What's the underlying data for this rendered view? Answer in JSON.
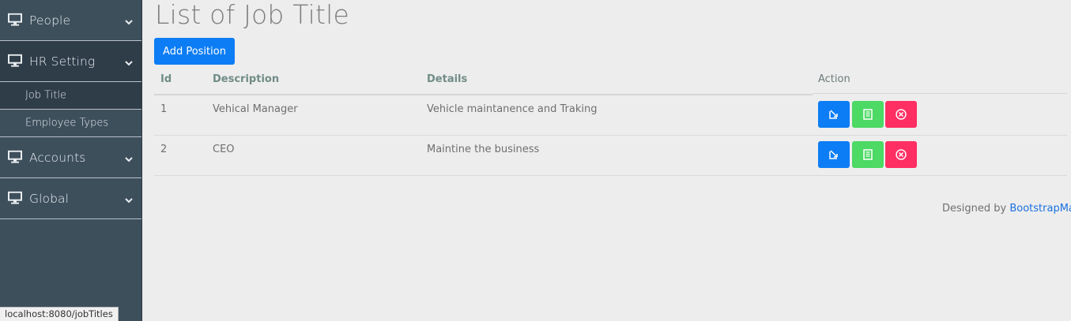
{
  "sidebar": {
    "items": [
      {
        "label": "People",
        "icon": "monitor-icon"
      },
      {
        "label": "HR Setting",
        "icon": "monitor-icon"
      },
      {
        "label": "Accounts",
        "icon": "monitor-icon"
      },
      {
        "label": "Global",
        "icon": "monitor-icon"
      }
    ],
    "subitems": [
      {
        "label": "Job Title"
      },
      {
        "label": "Employee Types"
      }
    ]
  },
  "status_url": "localhost:8080/jobTitles",
  "main": {
    "title": "List of Job Title",
    "add_button": "Add Position",
    "columns": [
      "Id",
      "Description",
      "Details",
      "Action"
    ],
    "rows": [
      {
        "id": "1",
        "description": "Vehical Manager",
        "details": "Vehicle maintanence and Traking"
      },
      {
        "id": "2",
        "description": "CEO",
        "details": "Maintine the business"
      }
    ]
  },
  "footer": {
    "text": "Designed by",
    "link": "BootstrapMad"
  },
  "colors": {
    "sidebar_bg": "#3e4f5c",
    "primary": "#0d7df5",
    "success": "#4cd964",
    "danger": "#ff2e63"
  }
}
